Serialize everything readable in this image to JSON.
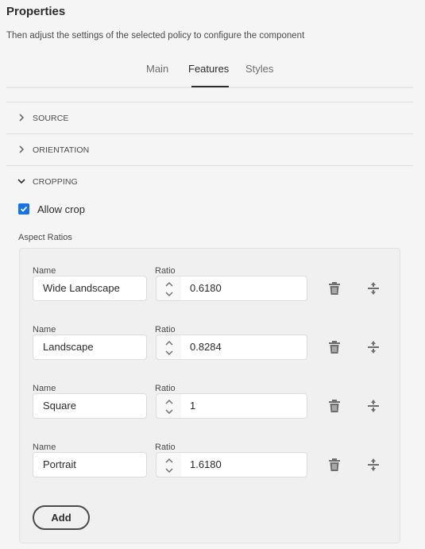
{
  "header": {
    "title": "Properties",
    "subtitle": "Then adjust the settings of the selected policy to configure the component"
  },
  "tabs": [
    {
      "label": "Main",
      "active": false
    },
    {
      "label": "Features",
      "active": true
    },
    {
      "label": "Styles",
      "active": false
    }
  ],
  "sections": [
    {
      "label": "SOURCE",
      "expanded": false
    },
    {
      "label": "ORIENTATION",
      "expanded": false
    },
    {
      "label": "CROPPING",
      "expanded": true
    }
  ],
  "cropping": {
    "allow_crop_label": "Allow crop",
    "allow_crop_checked": true,
    "aspect_ratios_label": "Aspect Ratios",
    "name_label": "Name",
    "ratio_label": "Ratio",
    "items": [
      {
        "name": "Wide Landscape",
        "ratio": "0.6180"
      },
      {
        "name": "Landscape",
        "ratio": "0.8284"
      },
      {
        "name": "Square",
        "ratio": "1"
      },
      {
        "name": "Portrait",
        "ratio": "1.6180"
      }
    ],
    "add_label": "Add"
  },
  "colors": {
    "accent": "#1473e6",
    "background": "#f5f5f5",
    "panel": "#f0f0f0"
  }
}
